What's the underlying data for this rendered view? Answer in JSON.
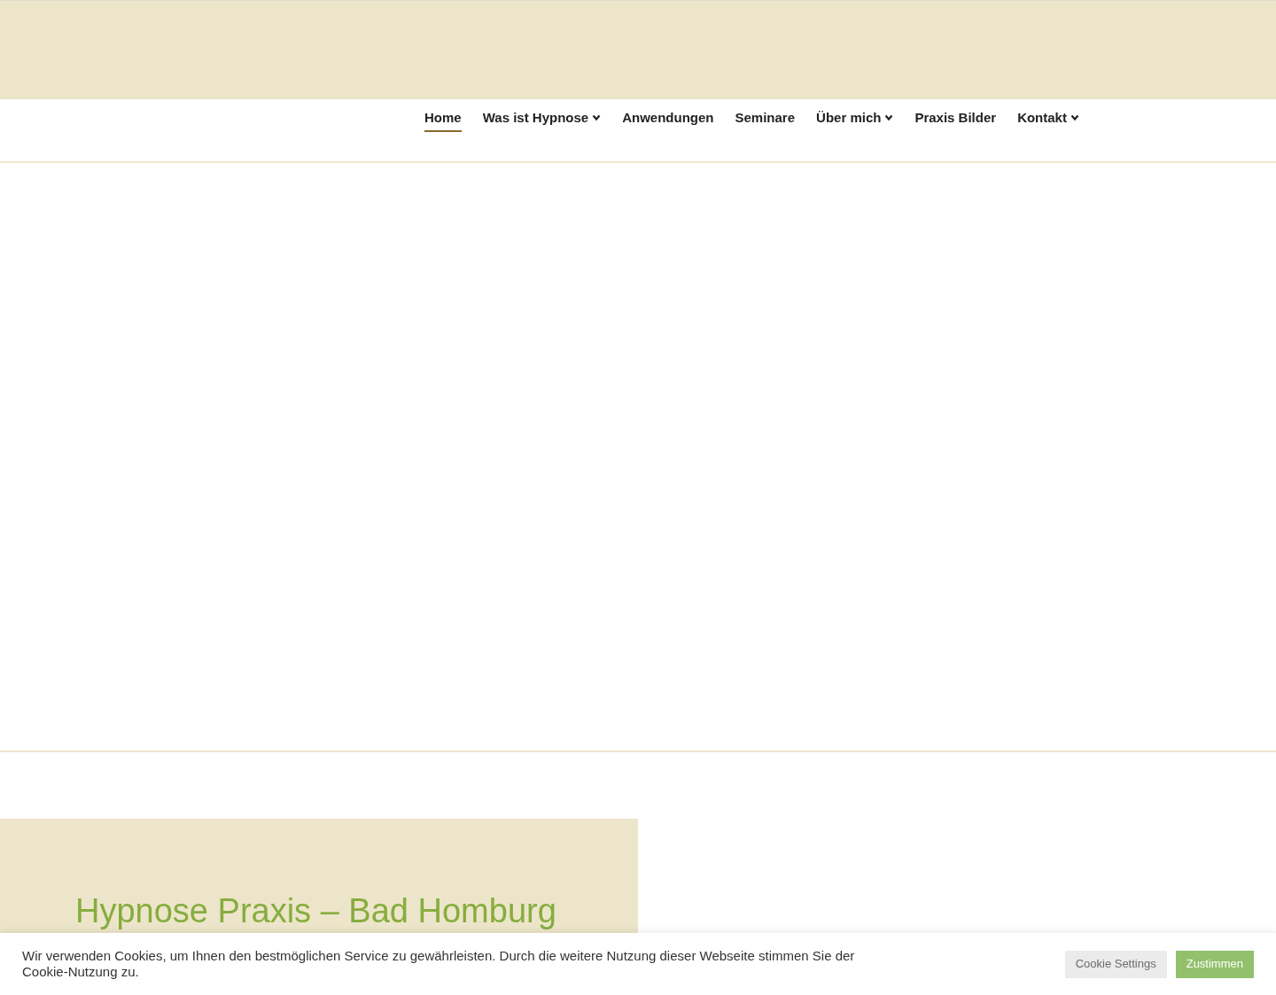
{
  "nav": [
    {
      "label": "Home",
      "selected": true,
      "has_dropdown": false
    },
    {
      "label": "Was ist Hypnose",
      "selected": false,
      "has_dropdown": true
    },
    {
      "label": "Anwendungen",
      "selected": false,
      "has_dropdown": false
    },
    {
      "label": "Seminare",
      "selected": false,
      "has_dropdown": false
    },
    {
      "label": "Über mich",
      "selected": false,
      "has_dropdown": true
    },
    {
      "label": "Praxis Bilder",
      "selected": false,
      "has_dropdown": false
    },
    {
      "label": "Kontakt",
      "selected": false,
      "has_dropdown": true
    }
  ],
  "intro": {
    "heading": "Hypnose Praxis – Bad Homburg"
  },
  "cookie_bar": {
    "message": "Wir verwenden Cookies, um Ihnen den bestmöglichen Service zu gewährleisten. Durch die weitere Nutzung dieser Webseite stimmen Sie der Cookie-Nutzung zu.",
    "buttons": [
      "Cookie Settings",
      "Zustimmen"
    ]
  }
}
